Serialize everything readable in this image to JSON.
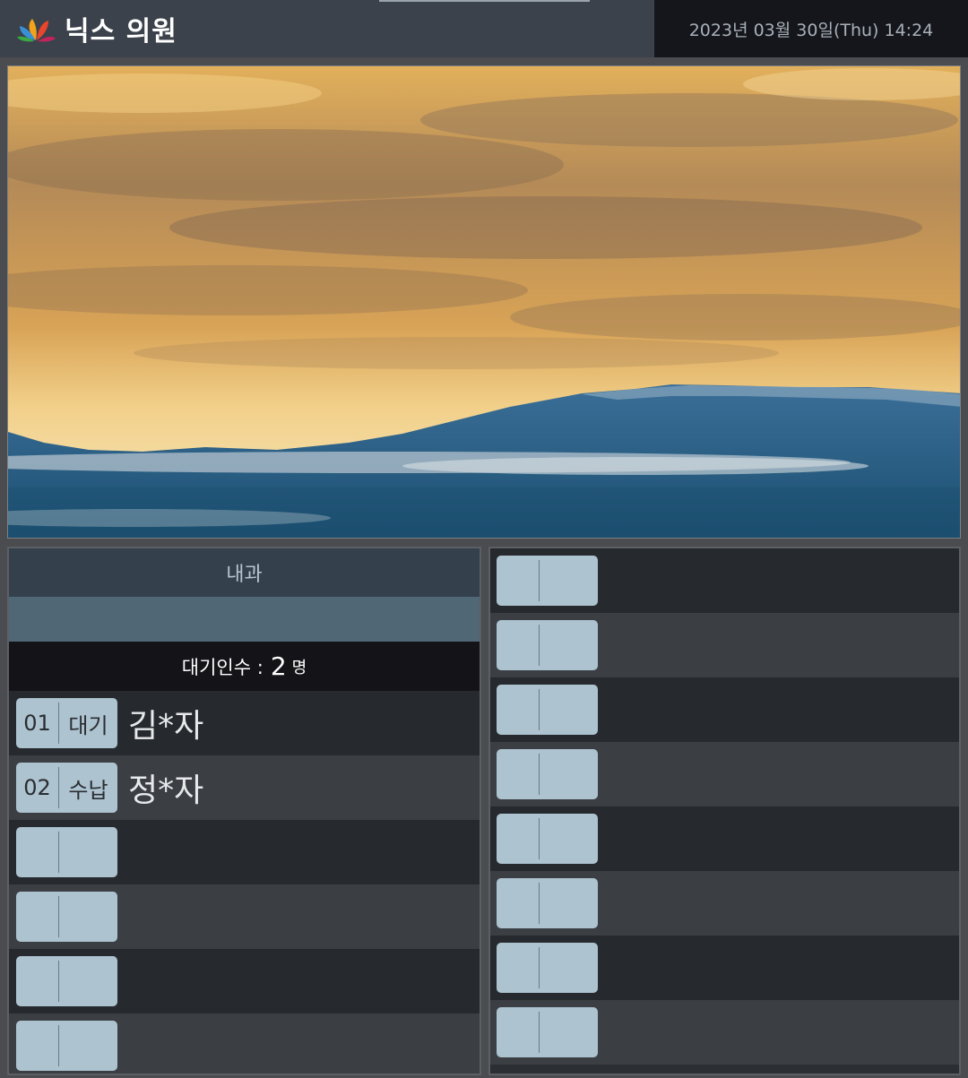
{
  "header": {
    "clinic_name": "닉스 의원",
    "datetime": "2023년 03월 30일(Thu) 14:24"
  },
  "department": {
    "name": "내과",
    "sub_label": "",
    "waiting_label": "대기인수 :",
    "waiting_count": "2",
    "waiting_unit": "명",
    "queue": [
      {
        "num": "01",
        "status": "대기",
        "name": "김*자"
      },
      {
        "num": "02",
        "status": "수납",
        "name": "정*자"
      },
      {
        "num": "",
        "status": "",
        "name": ""
      },
      {
        "num": "",
        "status": "",
        "name": ""
      },
      {
        "num": "",
        "status": "",
        "name": ""
      },
      {
        "num": "",
        "status": "",
        "name": ""
      }
    ]
  },
  "right_queue": [
    {
      "num": "",
      "status": "",
      "name": ""
    },
    {
      "num": "",
      "status": "",
      "name": ""
    },
    {
      "num": "",
      "status": "",
      "name": ""
    },
    {
      "num": "",
      "status": "",
      "name": ""
    },
    {
      "num": "",
      "status": "",
      "name": ""
    },
    {
      "num": "",
      "status": "",
      "name": ""
    },
    {
      "num": "",
      "status": "",
      "name": ""
    },
    {
      "num": "",
      "status": "",
      "name": ""
    }
  ],
  "icons": {
    "logo": "clinic-logo-icon"
  },
  "colors": {
    "chip": "#adc3d0",
    "header_bg": "#3b424b",
    "datetime_bg": "#14161c",
    "dept_title_bg": "#34404c",
    "dept_sub_bg": "#506776"
  }
}
